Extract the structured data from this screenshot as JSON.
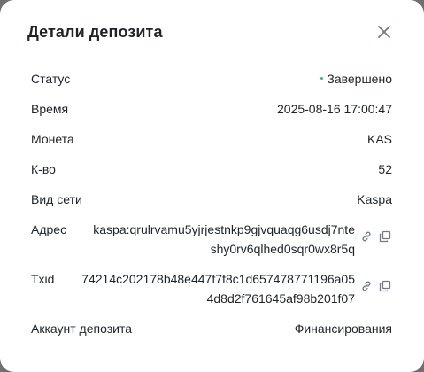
{
  "modal": {
    "title": "Детали депозита"
  },
  "status": {
    "label": "Статус",
    "value": "Завершено",
    "color": "#2ebd85"
  },
  "time": {
    "label": "Время",
    "value": "2025-08-16 17:00:47"
  },
  "coin": {
    "label": "Монета",
    "value": "KAS"
  },
  "amount": {
    "label": "К-во",
    "value": "52"
  },
  "network": {
    "label": "Вид сети",
    "value": "Kaspa"
  },
  "address": {
    "label": "Адрес",
    "line1": "kaspa:qrulrvamu5yjrjestnkp9gjvquaqg6usdj7nte",
    "line2": "shy0rv6qlhed0sqr0wx8r5q"
  },
  "txid": {
    "label": "Txid",
    "line1": "74214c202178b48e447f7f8c1d657478771196a05",
    "line2": "4d8d2f761645af98b201f07"
  },
  "account": {
    "label": "Аккаунт депозита",
    "value": "Финансирования"
  },
  "icons": {
    "close": "close-icon",
    "link": "link-icon",
    "copy": "copy-icon"
  }
}
